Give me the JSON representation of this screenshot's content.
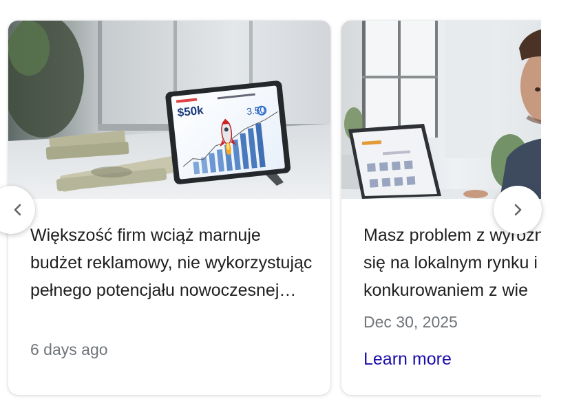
{
  "carousel": {
    "cards": [
      {
        "image_description_icon": "tablet-rocket-chart-money-photo",
        "title": "Większość firm wciąż marnuje budżet reklamowy, nie wykorzystując pełnego potencjału nowoczesnej…",
        "meta": "6 days ago"
      },
      {
        "image_description_icon": "man-laptop-office-photo",
        "title_lines": [
          "Masz problem z wyróżnieniem",
          "się na lokalnym rynku i",
          "konkurowaniem z wie"
        ],
        "meta": "Dec 30, 2025",
        "link": "Learn more"
      }
    ],
    "prev_icon": "chevron-left-icon",
    "next_icon": "chevron-right-icon"
  },
  "thumb1": {
    "price_label": "$50k",
    "value_label": "3.50"
  }
}
